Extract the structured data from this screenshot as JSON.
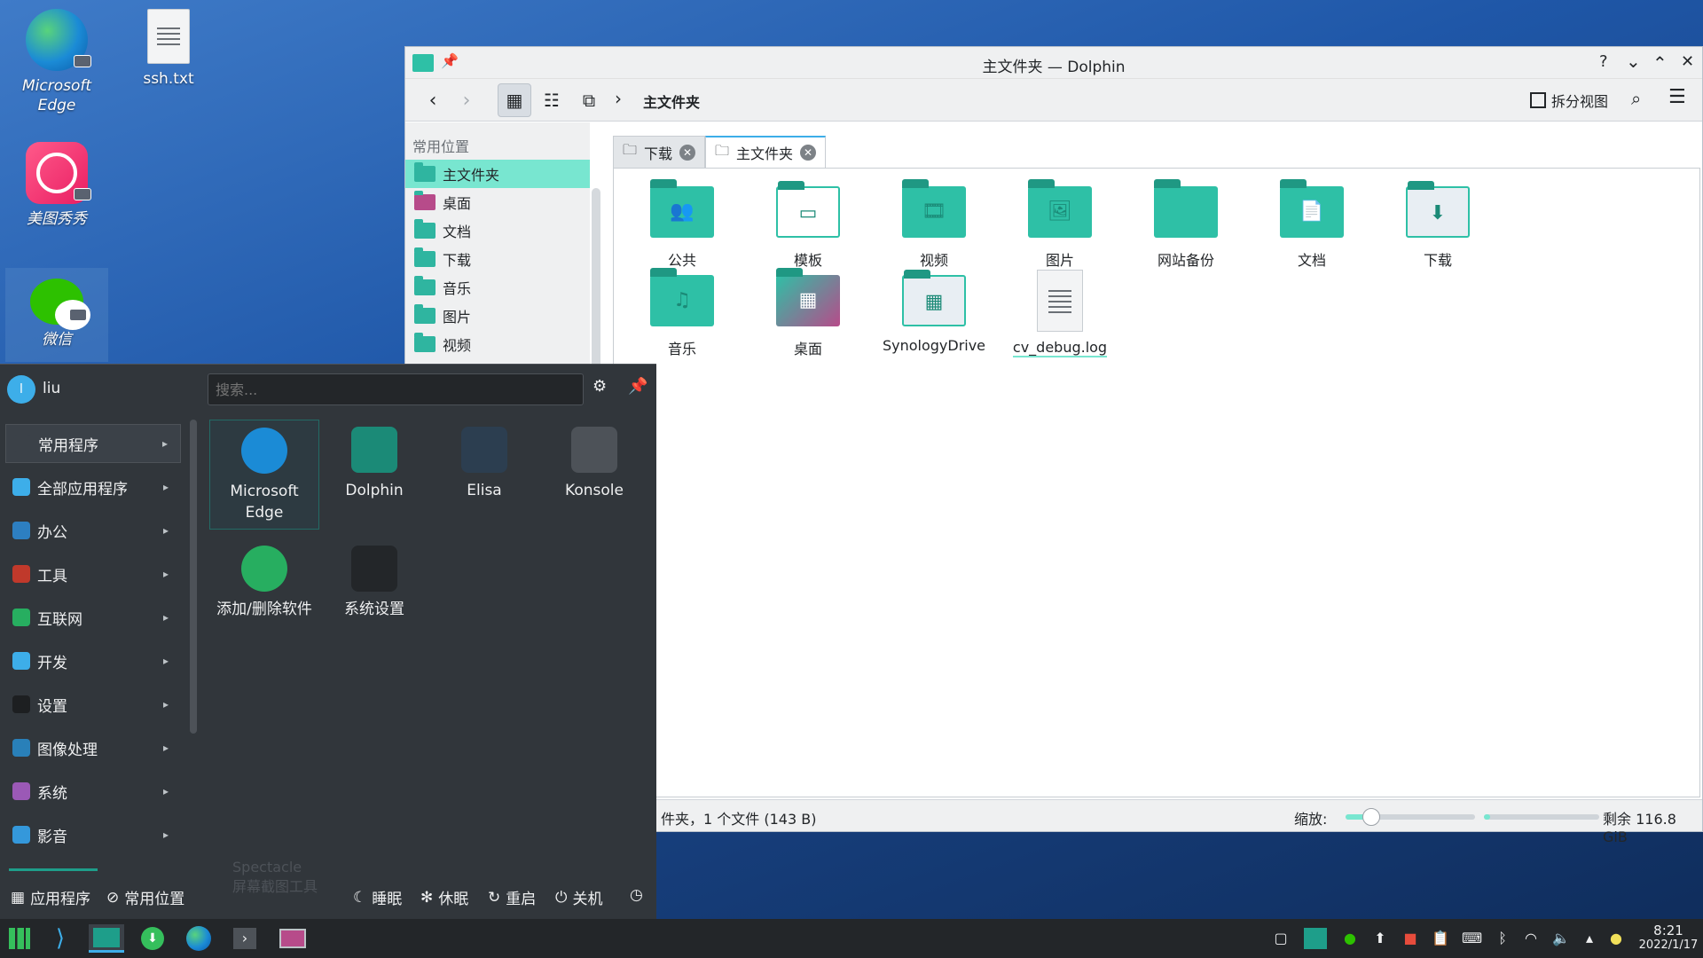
{
  "desktop": {
    "icons": [
      {
        "label": "Microsoft Edge"
      },
      {
        "label": "ssh.txt"
      },
      {
        "label": "美图秀秀"
      },
      {
        "label": "微信"
      }
    ]
  },
  "dolphin": {
    "title": "主文件夹 — Dolphin",
    "title_buttons": {
      "help": "?",
      "minimize": "⌄",
      "maximize": "⌃",
      "close": "✕"
    },
    "breadcrumb": "主文件夹",
    "split_view_label": "拆分视图",
    "places_title": "常用位置",
    "places": [
      {
        "label": "主文件夹",
        "active": true
      },
      {
        "label": "桌面"
      },
      {
        "label": "文档"
      },
      {
        "label": "下载"
      },
      {
        "label": "音乐"
      },
      {
        "label": "图片"
      },
      {
        "label": "视频"
      }
    ],
    "tabs": [
      {
        "label": "下载"
      },
      {
        "label": "主文件夹",
        "active": true
      }
    ],
    "items": [
      {
        "label": "公共",
        "symbol": "👥"
      },
      {
        "label": "模板",
        "symbol": "▭"
      },
      {
        "label": "视频",
        "symbol": "🎞"
      },
      {
        "label": "图片",
        "symbol": "🖼"
      },
      {
        "label": "网站备份",
        "symbol": ""
      },
      {
        "label": "文档",
        "symbol": "📄"
      },
      {
        "label": "下载",
        "symbol": "⬇"
      },
      {
        "label": "音乐",
        "symbol": "♫"
      },
      {
        "label": "桌面",
        "symbol": "▦"
      },
      {
        "label": "SynologyDrive",
        "symbol": "▦"
      },
      {
        "label": "cv_debug.log",
        "symbol": ""
      }
    ],
    "status": {
      "summary": "件夹，1 个文件 (143 B)",
      "zoom_label": "缩放:",
      "zoom_value": 0.2,
      "free_space_fill": 0.05,
      "free_space": "剩余 116.8 GiB"
    }
  },
  "menu": {
    "user": "liu",
    "user_initial": "l",
    "search_placeholder": "搜索...",
    "categories": [
      {
        "label": "常用程序",
        "color": "#3b4148",
        "active": true
      },
      {
        "label": "全部应用程序",
        "color": "#3daee9"
      },
      {
        "label": "办公",
        "color": "#2d7fc1"
      },
      {
        "label": "工具",
        "color": "#c0392b"
      },
      {
        "label": "互联网",
        "color": "#27ae60"
      },
      {
        "label": "开发",
        "color": "#3daee9"
      },
      {
        "label": "设置",
        "color": "#1d1f21"
      },
      {
        "label": "图像处理",
        "color": "#2980b9"
      },
      {
        "label": "系统",
        "color": "#9b59b6"
      },
      {
        "label": "影音",
        "color": "#3498db"
      }
    ],
    "apps": [
      {
        "label": "Microsoft Edge",
        "color": "#1b8bd6"
      },
      {
        "label": "Dolphin",
        "color": "#1b8a77"
      },
      {
        "label": "Elisa",
        "color": "#2c3e50"
      },
      {
        "label": "Konsole",
        "color": "#4d5258"
      },
      {
        "label": "添加/删除软件",
        "color": "#27ae60"
      },
      {
        "label": "系统设置",
        "color": "#232629"
      }
    ],
    "footer": {
      "apps": "应用程序",
      "places": "常用位置",
      "sleep": "睡眠",
      "hibernate": "休眠",
      "restart": "重启",
      "shutdown": "关机"
    },
    "ghost_label": "Spectacle",
    "ghost_sub": "屏幕截图工具"
  },
  "taskbar": {
    "clock_time": "8:21",
    "clock_date": "2022/1/17"
  }
}
